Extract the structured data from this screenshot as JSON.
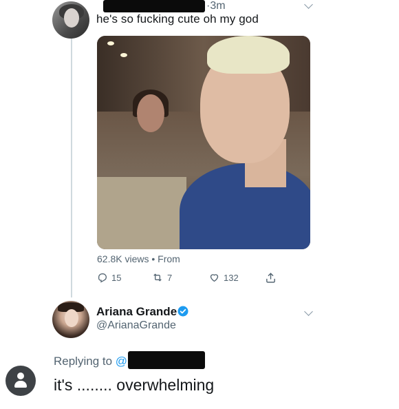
{
  "tweet": {
    "time": "·3m",
    "text": "he's so fucking cute oh my god",
    "media_alt": "photo of a young man with bleached blonde hair in a restaurant",
    "views": "62.8K views • From",
    "replies": "15",
    "retweets": "7",
    "likes": "132"
  },
  "reply": {
    "name": "Ariana Grande",
    "handle": "@ArianaGrande",
    "replying_to": "Replying to ",
    "replying_to_at": "@",
    "text": "it's ........ overwhelming"
  },
  "icons": {
    "reply": "reply-icon",
    "retweet": "retweet-icon",
    "like": "heart-icon",
    "share": "share-icon",
    "verified": "verified-badge-icon",
    "chevron": "chevron-down-icon",
    "profile": "profile-icon"
  },
  "colors": {
    "accent": "#1d9bf0",
    "secondary_text": "#536471",
    "redaction": "#0b0b0b"
  }
}
